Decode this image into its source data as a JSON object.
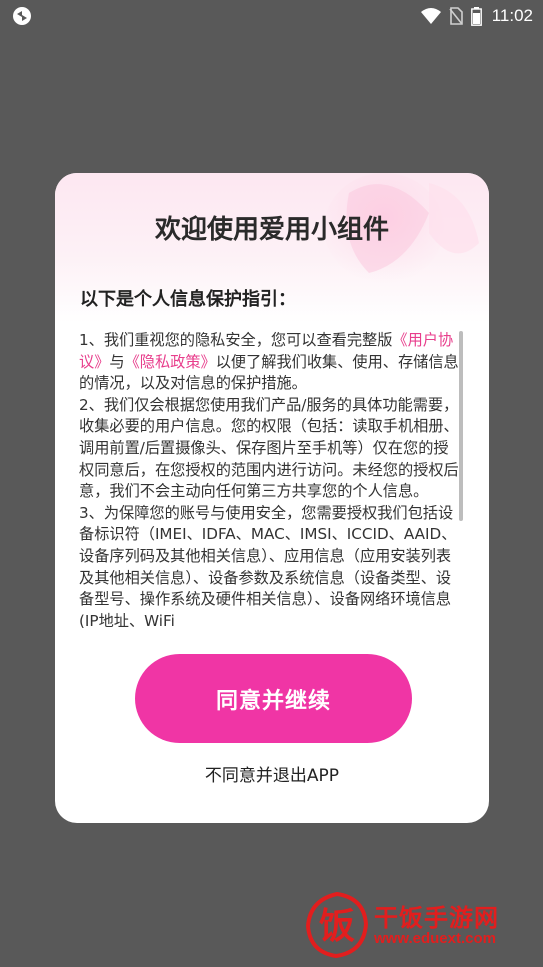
{
  "status_bar": {
    "time": "11:02",
    "left_icon": "app-notification-icon",
    "icons": [
      "wifi-icon",
      "no-sim-icon",
      "battery-icon"
    ]
  },
  "dialog": {
    "title": "欢迎使用爱用小组件",
    "subtitle": "以下是个人信息保护指引：",
    "policy": {
      "p1_prefix": "1、我们重视您的隐私安全，您可以查看完整版",
      "user_agreement_link": "《用户协议》",
      "and": "与",
      "privacy_policy_link": "《隐私政策》",
      "p1_suffix": "以便了解我们收集、使用、存储信息的情况，以及对信息的保护措施。",
      "p2": "2、我们仅会根据您使用我们产品/服务的具体功能需要，收集必要的用户信息。您的权限（包括：读取手机相册、调用前置/后置摄像头、保存图片至手机等）仅在您的授权同意后，在您授权的范围内进行访问。未经您的授权后意，我们不会主动向任何第三方共享您的个人信息。",
      "p3": "3、为保障您的账号与使用安全，您需要授权我们包括设备标识符（IMEI、IDFA、MAC、IMSI、ICCID、AAID、设备序列码及其他相关信息）、应用信息（应用安装列表及其他相关信息）、设备参数及系统信息（设备类型、设备型号、操作系统及硬件相关信息）、设备网络环境信息(IP地址、WiFi"
    },
    "agree_button": "同意并继续",
    "disagree_link": "不同意并退出APP",
    "accent_color": "#f035a5"
  },
  "watermark": {
    "logo_char": "饭",
    "name": "干饭手游网",
    "url": "www.eduext.com"
  }
}
